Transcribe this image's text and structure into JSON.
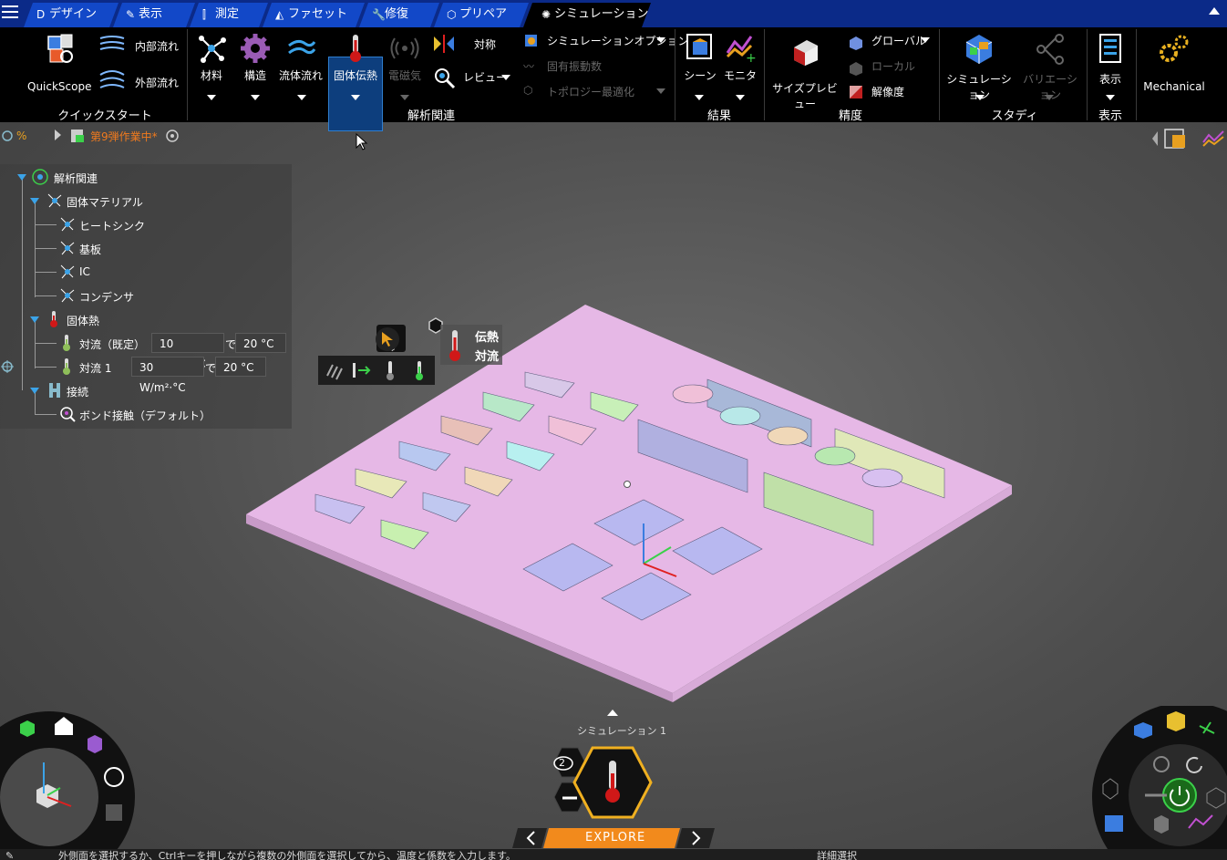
{
  "tabs": [
    {
      "label": "デザイン",
      "icon": "design-icon"
    },
    {
      "label": "表示",
      "icon": "display-icon"
    },
    {
      "label": "測定",
      "icon": "measure-icon"
    },
    {
      "label": "ファセット",
      "icon": "facet-icon"
    },
    {
      "label": "修復",
      "icon": "repair-icon"
    },
    {
      "label": "プリペア",
      "icon": "prepare-icon"
    },
    {
      "label": "シミュレーション",
      "icon": "simulation-icon"
    }
  ],
  "active_tab": "シミュレーション",
  "ribbon": {
    "quickstart": {
      "group_label": "クイックスタート",
      "quickscope": "QuickScope",
      "internal_flow": "内部流れ",
      "external_flow": "外部流れ"
    },
    "analysis": {
      "group_label": "解析関連",
      "material": "材料",
      "structure": "構造",
      "fluid_flow": "流体流れ",
      "solid_heat": "固体伝熱",
      "electromagnetic": "電磁気",
      "symmetry": "対称",
      "review": "レビュー",
      "sim_options": "シミュレーションオプション",
      "modal": "固有振動数",
      "topology": "トポロジー最適化"
    },
    "results": {
      "group_label": "結果",
      "scene": "シーン",
      "monitor": "モニタ"
    },
    "accuracy": {
      "group_label": "精度",
      "size_preview": "サイズプレビュー",
      "global": "グローバル",
      "local": "ローカル",
      "resolution": "解像度"
    },
    "study": {
      "group_label": "スタディ",
      "simulation": "シミュレーション",
      "variation": "バリエーション"
    },
    "display": {
      "group_label": "表示",
      "display": "表示"
    },
    "mechanical": "Mechanical"
  },
  "document_title": "第9弾作業中*",
  "tree": {
    "root": "解析関連",
    "solid_material": "固体マテリアル",
    "materials": [
      "ヒートシンク",
      "基板",
      "IC",
      "コンデンサ"
    ],
    "solid_heat": "固体熱",
    "convections": [
      {
        "label": "対流（既定）",
        "coef": "10 W/m²·°C",
        "at": "で",
        "temp": "20 °C"
      },
      {
        "label": "対流 1",
        "coef": "30 W/m²·°C",
        "at": "で",
        "temp": "20 °C"
      }
    ],
    "contact": "接続",
    "bond": "ボンド接触（デフォルト）"
  },
  "mini_toolbar": {
    "line1": "伝熱",
    "line2": "対流"
  },
  "simulation_label": "シミュレーション 1",
  "hex_count": "2",
  "explore_label": "EXPLORE",
  "status": {
    "hint": "外側面を選択するか、Ctrlキーを押しながら複数の外側面を選択してから、温度と係数を入力します。",
    "detail_select": "詳細選択"
  },
  "colors": {
    "tabbar": "#0b2a88",
    "tab": "#1248c8",
    "board": "#e6b8e6",
    "accent_orange": "#f07a1e",
    "explore": "#f28a1c"
  }
}
